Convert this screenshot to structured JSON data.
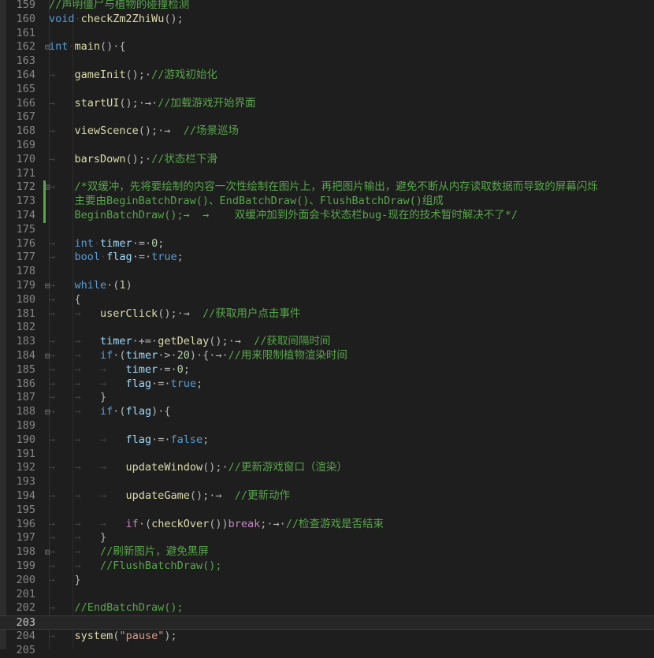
{
  "editor": {
    "language": "C++",
    "current_line": 203,
    "colors": {
      "background": "#1e1e1e",
      "comment": "#57a64a",
      "keyword": "#569cd6",
      "function": "#dcdcaa",
      "variable": "#9cdcfe",
      "number": "#b5cea8",
      "string": "#d69d85",
      "line_number": "#858585"
    },
    "lines": [
      {
        "num": "159",
        "tokens": [
          {
            "t": "//声明僵尸与植物的碰撞检测",
            "c": "cm"
          }
        ]
      },
      {
        "num": "160",
        "tokens": [
          {
            "t": "void",
            "c": "kw"
          },
          {
            "t": "·",
            "c": "ws"
          },
          {
            "t": "checkZm2ZhiWu",
            "c": "fn"
          },
          {
            "t": "();",
            "c": "pu"
          }
        ]
      },
      {
        "num": "161",
        "tokens": []
      },
      {
        "num": "162",
        "fold": "⊟",
        "tokens": [
          {
            "t": "int",
            "c": "kw"
          },
          {
            "t": "·",
            "c": "ws"
          },
          {
            "t": "main",
            "c": "fn"
          },
          {
            "t": "()·{",
            "c": "pu"
          }
        ]
      },
      {
        "num": "163",
        "tokens": []
      },
      {
        "num": "164",
        "tokens": [
          {
            "t": "→   ",
            "c": "ws"
          },
          {
            "t": "gameInit",
            "c": "fn"
          },
          {
            "t": "();·",
            "c": "pu"
          },
          {
            "t": "//游戏初始化",
            "c": "cm"
          }
        ]
      },
      {
        "num": "165",
        "tokens": []
      },
      {
        "num": "166",
        "tokens": [
          {
            "t": "→   ",
            "c": "ws"
          },
          {
            "t": "startUI",
            "c": "fn"
          },
          {
            "t": "();·→·",
            "c": "pu"
          },
          {
            "t": "//加载游戏开始界面",
            "c": "cm"
          }
        ]
      },
      {
        "num": "167",
        "tokens": []
      },
      {
        "num": "168",
        "tokens": [
          {
            "t": "→   ",
            "c": "ws"
          },
          {
            "t": "viewScence",
            "c": "fn"
          },
          {
            "t": "();·→  ",
            "c": "pu"
          },
          {
            "t": "//场景巡场",
            "c": "cm"
          }
        ]
      },
      {
        "num": "169",
        "tokens": []
      },
      {
        "num": "170",
        "tokens": [
          {
            "t": "→   ",
            "c": "ws"
          },
          {
            "t": "barsDown",
            "c": "fn"
          },
          {
            "t": "();·",
            "c": "pu"
          },
          {
            "t": "//状态栏下滑",
            "c": "cm"
          }
        ]
      },
      {
        "num": "171",
        "tokens": []
      },
      {
        "num": "172",
        "fold": "⊟",
        "bar": true,
        "tokens": [
          {
            "t": "→   ",
            "c": "ws"
          },
          {
            "t": "/*双缓冲，先将要绘制的内容一次性绘制在图片上，再把图片输出，避免不断从内存读取数据而导致的屏幕闪烁",
            "c": "cm"
          }
        ]
      },
      {
        "num": "173",
        "bar": true,
        "tokens": [
          {
            "t": "    ",
            "c": "ws"
          },
          {
            "t": "主要由BeginBatchDraw()、EndBatchDraw()、FlushBatchDraw()组成",
            "c": "cm"
          }
        ]
      },
      {
        "num": "174",
        "bar": true,
        "tokens": [
          {
            "t": "    ",
            "c": "ws"
          },
          {
            "t": "BeginBatchDraw();→  →    双缓冲加到外面会卡状态栏bug-现在的技术暂时解决不了*/",
            "c": "cm"
          }
        ]
      },
      {
        "num": "175",
        "tokens": []
      },
      {
        "num": "176",
        "tokens": [
          {
            "t": "→   ",
            "c": "ws"
          },
          {
            "t": "int",
            "c": "kw"
          },
          {
            "t": "·",
            "c": "ws"
          },
          {
            "t": "timer",
            "c": "vr"
          },
          {
            "t": "·=·",
            "c": "pu"
          },
          {
            "t": "0",
            "c": "nm"
          },
          {
            "t": ";",
            "c": "pu"
          }
        ]
      },
      {
        "num": "177",
        "tokens": [
          {
            "t": "→   ",
            "c": "ws"
          },
          {
            "t": "bool",
            "c": "kw"
          },
          {
            "t": "·",
            "c": "ws"
          },
          {
            "t": "flag",
            "c": "vr"
          },
          {
            "t": "·=·",
            "c": "pu"
          },
          {
            "t": "true",
            "c": "kw"
          },
          {
            "t": ";",
            "c": "pu"
          }
        ]
      },
      {
        "num": "178",
        "tokens": []
      },
      {
        "num": "179",
        "fold": "⊟",
        "tokens": [
          {
            "t": "→   ",
            "c": "ws"
          },
          {
            "t": "while",
            "c": "kw"
          },
          {
            "t": "·(",
            "c": "pu"
          },
          {
            "t": "1",
            "c": "nm"
          },
          {
            "t": ")",
            "c": "pu"
          }
        ]
      },
      {
        "num": "180",
        "tokens": [
          {
            "t": "→   ",
            "c": "ws"
          },
          {
            "t": "{",
            "c": "pu"
          }
        ]
      },
      {
        "num": "181",
        "tokens": [
          {
            "t": "→   →   ",
            "c": "ws"
          },
          {
            "t": "userClick",
            "c": "fn"
          },
          {
            "t": "();·→  ",
            "c": "pu"
          },
          {
            "t": "//获取用户点击事件",
            "c": "cm"
          }
        ]
      },
      {
        "num": "182",
        "tokens": []
      },
      {
        "num": "183",
        "tokens": [
          {
            "t": "→   →   ",
            "c": "ws"
          },
          {
            "t": "timer",
            "c": "vr"
          },
          {
            "t": "·+=·",
            "c": "pu"
          },
          {
            "t": "getDelay",
            "c": "fn"
          },
          {
            "t": "();·→  ",
            "c": "pu"
          },
          {
            "t": "//获取间隔时间",
            "c": "cm"
          }
        ]
      },
      {
        "num": "184",
        "fold": "⊟",
        "tokens": [
          {
            "t": "→   →   ",
            "c": "ws"
          },
          {
            "t": "if",
            "c": "kw"
          },
          {
            "t": "·(",
            "c": "pu"
          },
          {
            "t": "timer",
            "c": "vr"
          },
          {
            "t": "·>·",
            "c": "pu"
          },
          {
            "t": "20",
            "c": "nm"
          },
          {
            "t": ")·{·→·",
            "c": "pu"
          },
          {
            "t": "//用来限制植物渲染时间",
            "c": "cm"
          }
        ]
      },
      {
        "num": "185",
        "tokens": [
          {
            "t": "→   →   →   ",
            "c": "ws"
          },
          {
            "t": "timer",
            "c": "vr"
          },
          {
            "t": "·=·",
            "c": "pu"
          },
          {
            "t": "0",
            "c": "nm"
          },
          {
            "t": ";",
            "c": "pu"
          }
        ]
      },
      {
        "num": "186",
        "tokens": [
          {
            "t": "→   →   →   ",
            "c": "ws"
          },
          {
            "t": "flag",
            "c": "vr"
          },
          {
            "t": "·=·",
            "c": "pu"
          },
          {
            "t": "true",
            "c": "kw"
          },
          {
            "t": ";",
            "c": "pu"
          }
        ]
      },
      {
        "num": "187",
        "tokens": [
          {
            "t": "→   →   ",
            "c": "ws"
          },
          {
            "t": "}",
            "c": "pu"
          }
        ]
      },
      {
        "num": "188",
        "fold": "⊟",
        "tokens": [
          {
            "t": "→   →   ",
            "c": "ws"
          },
          {
            "t": "if",
            "c": "kw"
          },
          {
            "t": "·(",
            "c": "pu"
          },
          {
            "t": "flag",
            "c": "vr"
          },
          {
            "t": ")·{",
            "c": "pu"
          }
        ]
      },
      {
        "num": "189",
        "tokens": []
      },
      {
        "num": "190",
        "tokens": [
          {
            "t": "→   →   →   ",
            "c": "ws"
          },
          {
            "t": "flag",
            "c": "vr"
          },
          {
            "t": "·=·",
            "c": "pu"
          },
          {
            "t": "false",
            "c": "kw"
          },
          {
            "t": ";",
            "c": "pu"
          }
        ]
      },
      {
        "num": "191",
        "tokens": []
      },
      {
        "num": "192",
        "tokens": [
          {
            "t": "→   →   →   ",
            "c": "ws"
          },
          {
            "t": "updateWindow",
            "c": "fn"
          },
          {
            "t": "();·",
            "c": "pu"
          },
          {
            "t": "//更新游戏窗口（渲染）",
            "c": "cm"
          }
        ]
      },
      {
        "num": "193",
        "tokens": []
      },
      {
        "num": "194",
        "tokens": [
          {
            "t": "→   →   →   ",
            "c": "ws"
          },
          {
            "t": "updateGame",
            "c": "fn"
          },
          {
            "t": "();·→  ",
            "c": "pu"
          },
          {
            "t": "//更新动作",
            "c": "cm"
          }
        ]
      },
      {
        "num": "195",
        "tokens": []
      },
      {
        "num": "196",
        "tokens": [
          {
            "t": "→   →   →   ",
            "c": "ws"
          },
          {
            "t": "if",
            "c": "pp"
          },
          {
            "t": "·(",
            "c": "pu"
          },
          {
            "t": "checkOver",
            "c": "fn"
          },
          {
            "t": "())",
            "c": "pu"
          },
          {
            "t": "break",
            "c": "pp"
          },
          {
            "t": ";·→·",
            "c": "pu"
          },
          {
            "t": "//检查游戏是否结束",
            "c": "cm"
          }
        ]
      },
      {
        "num": "197",
        "tokens": [
          {
            "t": "→   →   ",
            "c": "ws"
          },
          {
            "t": "}",
            "c": "pu"
          }
        ]
      },
      {
        "num": "198",
        "fold": "⊟",
        "tokens": [
          {
            "t": "→   →   ",
            "c": "ws"
          },
          {
            "t": "//刷新图片，避免黑屏",
            "c": "cm"
          }
        ]
      },
      {
        "num": "199",
        "tokens": [
          {
            "t": "→   →   ",
            "c": "ws"
          },
          {
            "t": "//FlushBatchDraw();",
            "c": "cm"
          }
        ]
      },
      {
        "num": "200",
        "tokens": [
          {
            "t": "→   ",
            "c": "ws"
          },
          {
            "t": "}",
            "c": "pu"
          }
        ]
      },
      {
        "num": "201",
        "tokens": []
      },
      {
        "num": "202",
        "tokens": [
          {
            "t": "→   ",
            "c": "ws"
          },
          {
            "t": "//EndBatchDraw();",
            "c": "cm"
          }
        ]
      },
      {
        "num": "203",
        "tokens": []
      },
      {
        "num": "204",
        "tokens": [
          {
            "t": "→   ",
            "c": "ws"
          },
          {
            "t": "system",
            "c": "fn"
          },
          {
            "t": "(",
            "c": "pu"
          },
          {
            "t": "\"pause\"",
            "c": "st"
          },
          {
            "t": ");",
            "c": "pu"
          }
        ]
      },
      {
        "num": "205",
        "tokens": []
      }
    ]
  }
}
